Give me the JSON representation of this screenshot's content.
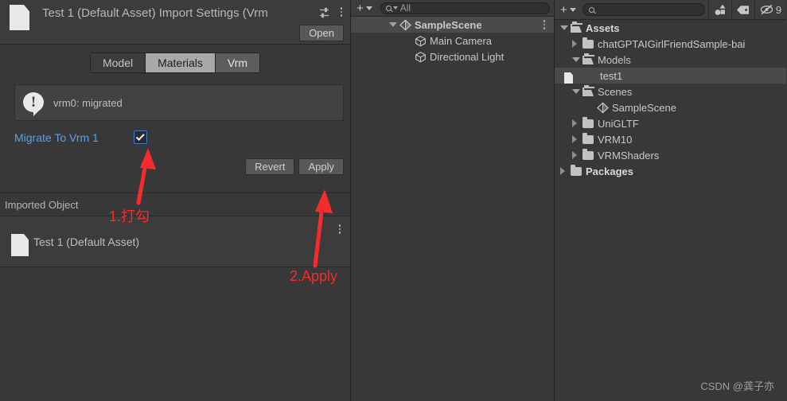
{
  "inspector": {
    "title": "Test 1 (Default Asset) Import Settings (Vrm",
    "file_icon": "file-icon",
    "preset_icon": "preset-icon",
    "menu_icon": "kebab-menu-icon",
    "open_label": "Open",
    "tabs": [
      {
        "label": "Model",
        "state": "normal"
      },
      {
        "label": "Materials",
        "state": "light"
      },
      {
        "label": "Vrm",
        "state": "active"
      }
    ],
    "helpbox": {
      "icon": "info-bubble-icon",
      "text": "vrm0: migrated"
    },
    "property": {
      "label": "Migrate To Vrm 1",
      "checked": true,
      "label_color": "#5b9fe8",
      "check_border_color": "#3a7fd5"
    },
    "buttons": {
      "revert": "Revert",
      "apply": "Apply"
    },
    "imported_section": {
      "header": "Imported Object",
      "item_label": "Test 1 (Default Asset)",
      "item_icon": "file-icon",
      "item_menu_icon": "kebab-menu-icon"
    }
  },
  "hierarchy": {
    "toolbar": {
      "add_icon": "plus-icon",
      "dropdown_icon": "chevron-down-icon",
      "search_icon": "search-icon",
      "search_value": "All"
    },
    "rows": [
      {
        "label": "SampleScene",
        "icon": "scene-icon",
        "indent": 0,
        "expanded": true,
        "selected": true,
        "bold": true,
        "menu": true
      },
      {
        "label": "Main Camera",
        "icon": "gameobject-cube-icon",
        "indent": 1,
        "expanded": null,
        "selected": false,
        "bold": false,
        "menu": false
      },
      {
        "label": "Directional Light",
        "icon": "gameobject-cube-icon",
        "indent": 1,
        "expanded": null,
        "selected": false,
        "bold": false,
        "menu": false
      }
    ]
  },
  "project": {
    "toolbar": {
      "add_icon": "plus-icon",
      "dropdown_icon": "chevron-down-icon",
      "search_icon": "search-icon",
      "search_placeholder": "",
      "filter_type_icon": "shape-filter-icon",
      "filter_label_icon": "tag-icon",
      "hidden_count_icon": "eye-off-icon",
      "hidden_count": "9"
    },
    "rows": [
      {
        "label": "Assets",
        "icon": "folder-open-icon",
        "indent": 0,
        "expanded": true,
        "selected": false,
        "bold": true
      },
      {
        "label": "chatGPTAIGirlFriendSample-bai",
        "icon": "folder-icon",
        "indent": 1,
        "expanded": false,
        "selected": false,
        "bold": false
      },
      {
        "label": "Models",
        "icon": "folder-open-icon",
        "indent": 1,
        "expanded": true,
        "selected": false,
        "bold": false
      },
      {
        "label": "test1",
        "icon": "file-icon",
        "indent": 2,
        "expanded": null,
        "selected": true,
        "bold": false
      },
      {
        "label": "Scenes",
        "icon": "folder-open-icon",
        "indent": 1,
        "expanded": true,
        "selected": false,
        "bold": false
      },
      {
        "label": "SampleScene",
        "icon": "scene-icon",
        "indent": 2,
        "expanded": null,
        "selected": false,
        "bold": false
      },
      {
        "label": "UniGLTF",
        "icon": "folder-icon",
        "indent": 1,
        "expanded": false,
        "selected": false,
        "bold": false
      },
      {
        "label": "VRM10",
        "icon": "folder-icon",
        "indent": 1,
        "expanded": false,
        "selected": false,
        "bold": false
      },
      {
        "label": "VRMShaders",
        "icon": "folder-icon",
        "indent": 1,
        "expanded": false,
        "selected": false,
        "bold": false
      },
      {
        "label": "Packages",
        "icon": "folder-icon",
        "indent": 0,
        "expanded": false,
        "selected": false,
        "bold": true
      }
    ]
  },
  "annotations": {
    "step1": "1.打勾",
    "step2": "2.Apply",
    "color": "#f42c2c"
  },
  "watermark": "CSDN @龚子亦"
}
